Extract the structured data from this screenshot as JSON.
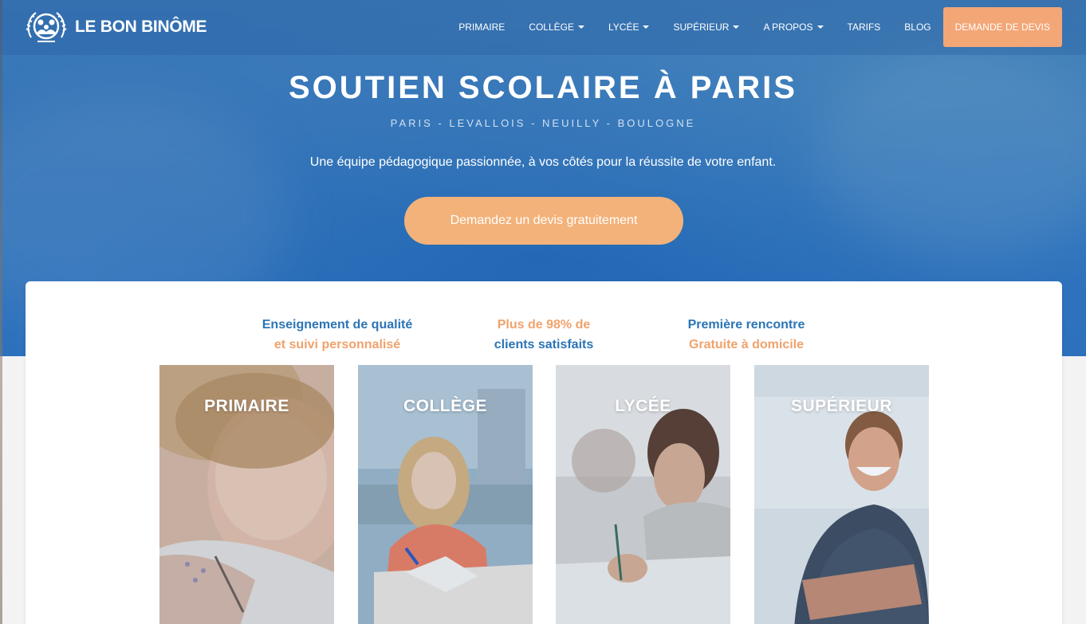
{
  "brand": {
    "name": "LE BON BINÔME",
    "logo_icon": "family-emblem-icon"
  },
  "nav": {
    "items": [
      {
        "label": "PRIMAIRE",
        "dropdown": false
      },
      {
        "label": "COLLÈGE",
        "dropdown": true
      },
      {
        "label": "LYCÉE",
        "dropdown": true
      },
      {
        "label": "SUPÉRIEUR",
        "dropdown": true
      },
      {
        "label": "A PROPOS",
        "dropdown": true
      },
      {
        "label": "TARIFS",
        "dropdown": false
      },
      {
        "label": "BLOG",
        "dropdown": false
      }
    ],
    "cta": "DEMANDE DE DEVIS"
  },
  "hero": {
    "title": "SOUTIEN SCOLAIRE À PARIS",
    "subtitle": "PARIS - LEVALLOIS - NEUILLY - BOULOGNE",
    "description": "Une équipe pédagogique passionnée, à vos côtés pour la réussite de votre enfant.",
    "button": "Demandez un devis gratuitement"
  },
  "features": [
    {
      "line1": "Enseignement de qualité",
      "line2": "et suivi personnalisé"
    },
    {
      "line1": "Plus de 98% de",
      "line2": "clients satisfaits"
    },
    {
      "line1": "Première rencontre",
      "line2": "Gratuite à domicile"
    }
  ],
  "tiles": [
    {
      "label": "PRIMAIRE"
    },
    {
      "label": "COLLÈGE"
    },
    {
      "label": "LYCÉE"
    },
    {
      "label": "SUPÉRIEUR"
    }
  ],
  "colors": {
    "brand_blue": "#2b74b6",
    "accent_orange": "#f3a676"
  }
}
